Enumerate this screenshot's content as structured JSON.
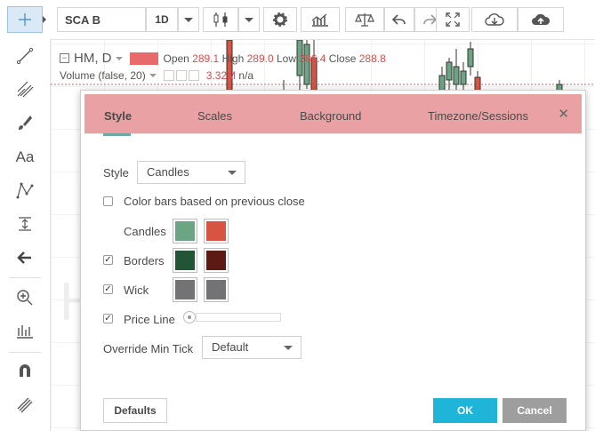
{
  "symbol": "SCA B",
  "interval": "1D",
  "legend": {
    "title": "HM, D",
    "open_label": "Open",
    "open_value": "289.1",
    "high_label": "High",
    "high_value": "289.0",
    "low_label": "Low",
    "low_value": "286.4",
    "close_label": "Close",
    "close_value": "288.8",
    "volume_label": "Volume (false, 20)",
    "volume_value": "3.32M",
    "volume_extra": "n/a"
  },
  "watermark": "H",
  "dialog": {
    "tabs": [
      "Style",
      "Scales",
      "Background",
      "Timezone/Sessions"
    ],
    "style_label": "Style",
    "style_value": "Candles",
    "color_bars_label": "Color bars based on previous close",
    "candles_label": "Candles",
    "borders_label": "Borders",
    "wick_label": "Wick",
    "price_line_label": "Price Line",
    "override_label": "Override Min Tick",
    "override_value": "Default",
    "defaults_button": "Defaults",
    "ok_button": "OK",
    "cancel_button": "Cancel"
  },
  "colors": {
    "candles_up": "#6ba583",
    "candles_down": "#d75442",
    "borders_up": "#225437",
    "borders_down": "#5b1a13",
    "wick_up": "#737375",
    "wick_down": "#737375",
    "header_bg": "#e9a1a3",
    "ok_bg": "#1eb5d9",
    "cancel_bg": "#9e9e9e"
  }
}
